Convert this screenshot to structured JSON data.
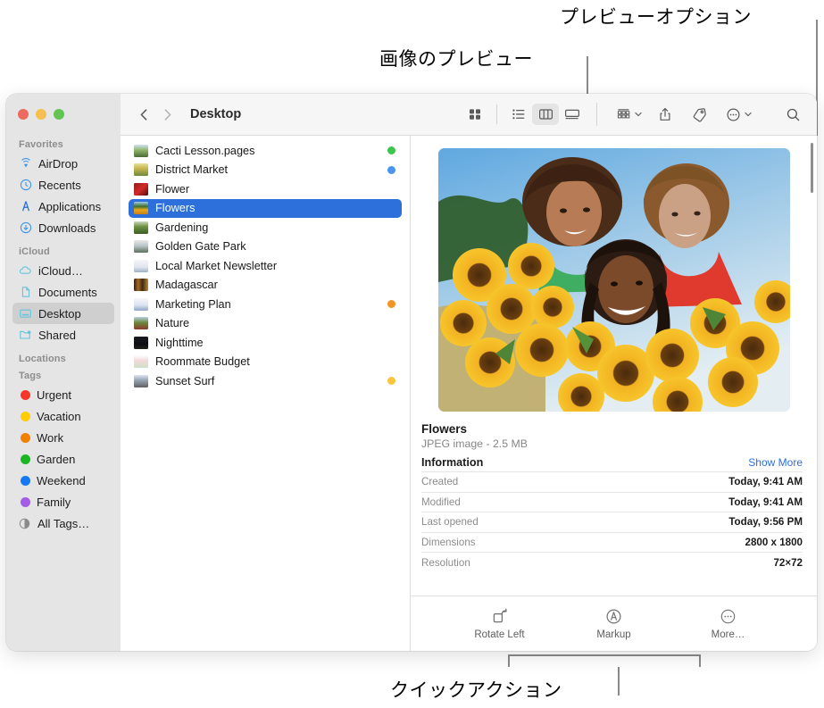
{
  "annotations": [
    {
      "name": "preview-options",
      "text": "プレビューオプション"
    },
    {
      "name": "image-preview",
      "text": "画像のプレビュー"
    },
    {
      "name": "quick-actions",
      "text": "クイックアクション"
    }
  ],
  "window": {
    "traffic_lights": [
      {
        "name": "close",
        "color": "#ec6a5e"
      },
      {
        "name": "minimize",
        "color": "#f5bf4f"
      },
      {
        "name": "zoom",
        "color": "#61c454"
      }
    ]
  },
  "toolbar": {
    "back_icon": "chevron-left-icon",
    "forward_icon": "chevron-right-icon",
    "title": "Desktop",
    "view_buttons": [
      {
        "name": "icon-view",
        "icon": "grid-icon",
        "active": false
      },
      {
        "name": "list-view",
        "icon": "list-icon",
        "active": false
      },
      {
        "name": "column-view",
        "icon": "columns-icon",
        "active": true
      },
      {
        "name": "gallery-view",
        "icon": "gallery-icon",
        "active": false
      }
    ],
    "actions": [
      {
        "name": "group-by",
        "icon": "group-icon",
        "has_chevron": true
      },
      {
        "name": "share",
        "icon": "share-icon",
        "has_chevron": false
      },
      {
        "name": "tags",
        "icon": "tag-icon",
        "has_chevron": false
      },
      {
        "name": "more-actions",
        "icon": "ellipsis-circle-icon",
        "has_chevron": true
      }
    ],
    "search": {
      "name": "search-button",
      "icon": "search-icon"
    }
  },
  "sidebar": {
    "sections": [
      {
        "title": "Favorites",
        "items": [
          {
            "label": "AirDrop",
            "icon": "airdrop-icon",
            "selected": false
          },
          {
            "label": "Recents",
            "icon": "clock-icon",
            "selected": false
          },
          {
            "label": "Applications",
            "icon": "applications-icon",
            "selected": false
          },
          {
            "label": "Downloads",
            "icon": "download-icon",
            "selected": false
          }
        ]
      },
      {
        "title": "iCloud",
        "items": [
          {
            "label": "iCloud…",
            "icon": "cloud-icon",
            "selected": false
          },
          {
            "label": "Documents",
            "icon": "document-icon",
            "selected": false
          },
          {
            "label": "Desktop",
            "icon": "desktop-icon",
            "selected": true
          },
          {
            "label": "Shared",
            "icon": "shared-folder-icon",
            "selected": false
          }
        ]
      },
      {
        "title": "Locations",
        "items": []
      },
      {
        "title": "Tags",
        "items": [
          {
            "label": "Urgent",
            "icon": "tag-dot-icon",
            "color": "#f6352b",
            "selected": false
          },
          {
            "label": "Vacation",
            "icon": "tag-dot-icon",
            "color": "#ffcc00",
            "selected": false
          },
          {
            "label": "Work",
            "icon": "tag-dot-icon",
            "color": "#f08000",
            "selected": false
          },
          {
            "label": "Garden",
            "icon": "tag-dot-icon",
            "color": "#1bb723",
            "selected": false
          },
          {
            "label": "Weekend",
            "icon": "tag-dot-icon",
            "color": "#1479f2",
            "selected": false
          },
          {
            "label": "Family",
            "icon": "tag-dot-icon",
            "color": "#a35be8",
            "selected": false
          },
          {
            "label": "All Tags…",
            "icon": "all-tags-icon",
            "color": "",
            "selected": false
          }
        ]
      }
    ]
  },
  "filelist": {
    "rows": [
      {
        "name": "Cacti Lesson.pages",
        "tag": "#3fc54c",
        "selected": false,
        "thumb": "doc-green"
      },
      {
        "name": "District Market",
        "tag": "#4a94f0",
        "selected": false,
        "thumb": "photo-market"
      },
      {
        "name": "Flower",
        "tag": "",
        "selected": false,
        "thumb": "photo-red"
      },
      {
        "name": "Flowers",
        "tag": "",
        "selected": true,
        "thumb": "photo-sunflower"
      },
      {
        "name": "Gardening",
        "tag": "",
        "selected": false,
        "thumb": "photo-garden"
      },
      {
        "name": "Golden Gate Park",
        "tag": "",
        "selected": false,
        "thumb": "photo-park"
      },
      {
        "name": "Local Market Newsletter",
        "tag": "",
        "selected": false,
        "thumb": "doc-plain"
      },
      {
        "name": "Madagascar",
        "tag": "",
        "selected": false,
        "thumb": "photo-dark"
      },
      {
        "name": "Marketing Plan",
        "tag": "#f39426",
        "selected": false,
        "thumb": "doc-plain"
      },
      {
        "name": "Nature",
        "tag": "",
        "selected": false,
        "thumb": "photo-nature"
      },
      {
        "name": "Nighttime",
        "tag": "",
        "selected": false,
        "thumb": "photo-night"
      },
      {
        "name": "Roommate Budget",
        "tag": "",
        "selected": false,
        "thumb": "doc-sheet"
      },
      {
        "name": "Sunset Surf",
        "tag": "#fbc53b",
        "selected": false,
        "thumb": "photo-surf"
      }
    ]
  },
  "preview": {
    "image_alt": "three-people-with-sunflowers-photo",
    "file_name": "Flowers",
    "file_meta": "JPEG image - 2.5 MB",
    "information_label": "Information",
    "show_more_label": "Show More",
    "rows": [
      {
        "key": "Created",
        "value": "Today, 9:41 AM"
      },
      {
        "key": "Modified",
        "value": "Today, 9:41 AM"
      },
      {
        "key": "Last opened",
        "value": "Today, 9:56 PM"
      },
      {
        "key": "Dimensions",
        "value": "2800 x 1800"
      },
      {
        "key": "Resolution",
        "value": "72×72"
      }
    ],
    "quick_actions": [
      {
        "label": "Rotate Left",
        "icon": "rotate-left-icon"
      },
      {
        "label": "Markup",
        "icon": "markup-icon"
      },
      {
        "label": "More…",
        "icon": "ellipsis-circle-icon"
      }
    ]
  },
  "colors": {
    "accent": "#2d6fdb",
    "link": "#2b6fe0",
    "sidebar_bg": "#e5e5e5",
    "toolbar_bg": "#f6f6f6",
    "callout": "#8a8a8a"
  }
}
